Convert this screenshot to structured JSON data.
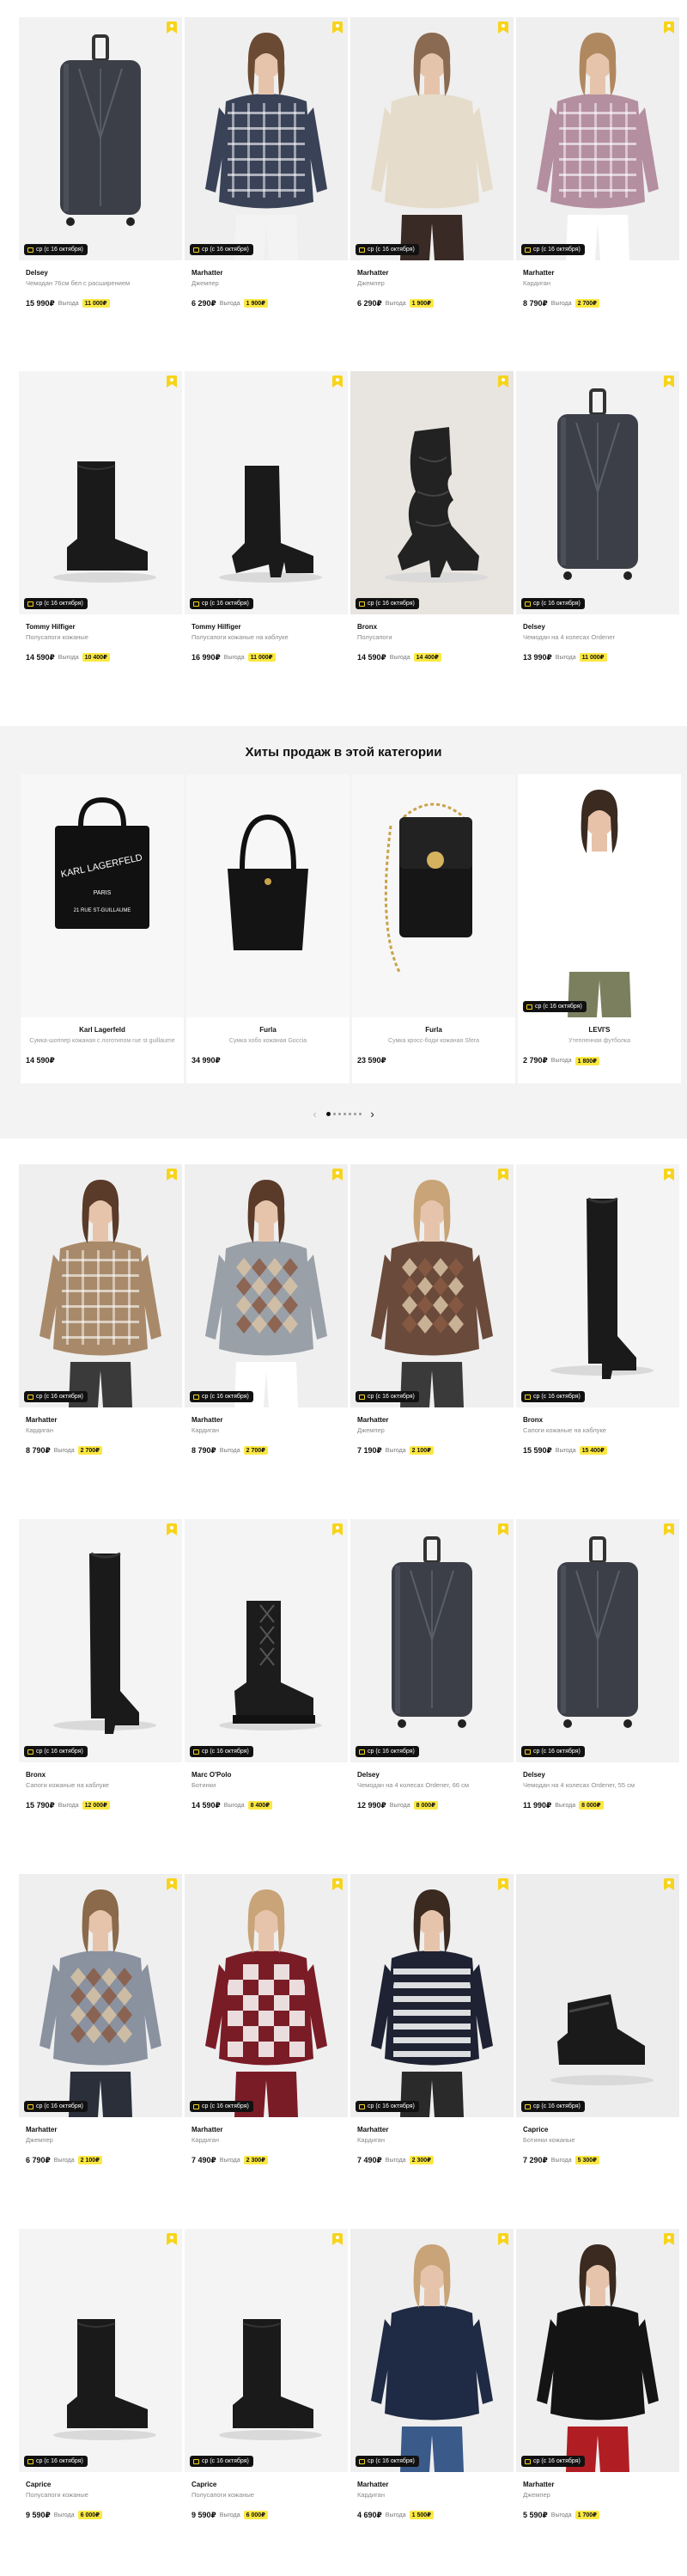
{
  "colors": {
    "accent_yellow": "#fbe843",
    "badge_bg": "#111111",
    "hits_bg": "#f3f3f3"
  },
  "delivery_label": "ср (с 16 октября)",
  "benefit_label": "Выгода",
  "top_products": [
    {
      "brand": "Delsey",
      "desc": "Чемодан 76см бел с расширением",
      "price": "15 990₽",
      "benefit": "11 000₽",
      "art": "suitcase"
    },
    {
      "brand": "Marhatter",
      "desc": "Джемпер",
      "price": "6 290₽",
      "benefit": "1 900₽",
      "art": "sweater-navy"
    },
    {
      "brand": "Marhatter",
      "desc": "Джемпер",
      "price": "6 290₽",
      "benefit": "1 900₽",
      "art": "sweater-cream"
    },
    {
      "brand": "Marhatter",
      "desc": "Кардиган",
      "price": "8 790₽",
      "benefit": "2 700₽",
      "art": "cardigan-pink"
    },
    {
      "brand": "Tommy Hilfiger",
      "desc": "Полусапоги кожаные",
      "price": "14 590₽",
      "benefit": "10 400₽",
      "art": "boot-ankle"
    },
    {
      "brand": "Tommy Hilfiger",
      "desc": "Полусапоги кожаные на каблуке",
      "price": "16 990₽",
      "benefit": "11 000₽",
      "art": "boot-heel"
    },
    {
      "brand": "Bronx",
      "desc": "Полусапоги",
      "price": "14 590₽",
      "benefit": "14 400₽",
      "art": "boot-slouch"
    },
    {
      "brand": "Delsey",
      "desc": "Чемодан на 4 колесах Ordener",
      "price": "13 990₽",
      "benefit": "11 000₽",
      "art": "suitcase"
    }
  ],
  "hits": {
    "title": "Хиты продаж в этой категории",
    "items": [
      {
        "brand": "Karl Lagerfeld",
        "desc": "Сумка-шоппер кожаная с логотипом rue st guillaume",
        "price": "14 590₽",
        "benefit": "",
        "art": "tote"
      },
      {
        "brand": "Furla",
        "desc": "Сумка хобо кожаная Goccia",
        "price": "34 990₽",
        "benefit": "",
        "art": "hobo"
      },
      {
        "brand": "Furla",
        "desc": "Сумка кросс-боди кожаная Sfera",
        "price": "23 590₽",
        "benefit": "",
        "art": "crossbody"
      },
      {
        "brand": "LEVI'S",
        "desc": "Утепленная футболка",
        "price": "2 790₽",
        "benefit": "1 800₽",
        "art": "tshirt",
        "delivery": true
      }
    ],
    "prev_arrow": "‹",
    "next_arrow": "›"
  },
  "bottom_products": [
    {
      "brand": "Marhatter",
      "desc": "Кардиган",
      "price": "8 790₽",
      "benefit": "2 700₽",
      "art": "cardigan-brown"
    },
    {
      "brand": "Marhatter",
      "desc": "Кардиган",
      "price": "8 790₽",
      "benefit": "2 700₽",
      "art": "cardigan-grey"
    },
    {
      "brand": "Marhatter",
      "desc": "Джемпер",
      "price": "7 190₽",
      "benefit": "2 100₽",
      "art": "sweater-argyle"
    },
    {
      "brand": "Bronx",
      "desc": "Сапоги кожаные на каблуке",
      "price": "15 590₽",
      "benefit": "15 400₽",
      "art": "boot-tall"
    },
    {
      "brand": "Bronx",
      "desc": "Сапоги кожаные на каблуке",
      "price": "15 790₽",
      "benefit": "12 000₽",
      "art": "boot-tall2"
    },
    {
      "brand": "Marc O'Polo",
      "desc": "Ботинки",
      "price": "14 590₽",
      "benefit": "8 400₽",
      "art": "boot-lace"
    },
    {
      "brand": "Delsey",
      "desc": "Чемодан на 4 колесах Ordener, 66 см",
      "price": "12 990₽",
      "benefit": "8 000₽",
      "art": "suitcase"
    },
    {
      "brand": "Delsey",
      "desc": "Чемодан на 4 колесах Ordener, 55 см",
      "price": "11 990₽",
      "benefit": "8 000₽",
      "art": "suitcase"
    },
    {
      "brand": "Marhatter",
      "desc": "Джемпер",
      "price": "6 790₽",
      "benefit": "2 100₽",
      "art": "sweater-argyle-grey"
    },
    {
      "brand": "Marhatter",
      "desc": "Кардиган",
      "price": "7 490₽",
      "benefit": "2 300₽",
      "art": "cardigan-red"
    },
    {
      "brand": "Marhatter",
      "desc": "Кардиган",
      "price": "7 490₽",
      "benefit": "2 300₽",
      "art": "cardigan-stripe"
    },
    {
      "brand": "Caprice",
      "desc": "Ботинки кожаные",
      "price": "7 290₽",
      "benefit": "5 300₽",
      "art": "shoe-low"
    },
    {
      "brand": "Caprice",
      "desc": "Полусапоги кожаные",
      "price": "9 590₽",
      "benefit": "6 000₽",
      "art": "boot-ankle2"
    },
    {
      "brand": "Caprice",
      "desc": "Полусапоги кожаные",
      "price": "9 590₽",
      "benefit": "6 000₽",
      "art": "boot-ankle3"
    },
    {
      "brand": "Marhatter",
      "desc": "Кардиган",
      "price": "4 690₽",
      "benefit": "1 500₽",
      "art": "cardigan-navy"
    },
    {
      "brand": "Marhatter",
      "desc": "Джемпер",
      "price": "5 590₽",
      "benefit": "1 700₽",
      "art": "sweater-black"
    }
  ]
}
